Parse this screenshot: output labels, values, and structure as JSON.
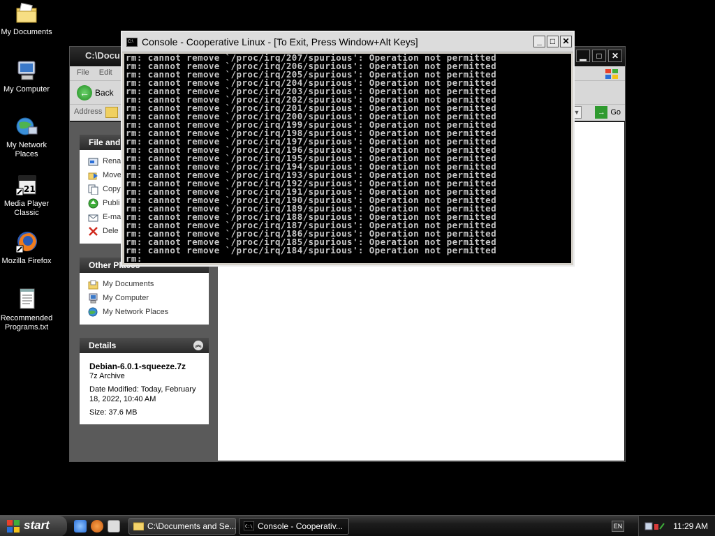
{
  "desktop": {
    "icons": [
      {
        "label": "My Documents"
      },
      {
        "label": "My Computer"
      },
      {
        "label": "My Network Places"
      },
      {
        "label": "Media Player Classic"
      },
      {
        "label": "Mozilla Firefox"
      },
      {
        "label": "Recommended Programs.txt"
      }
    ]
  },
  "explorer": {
    "title": "C:\\Docu",
    "menu": [
      "File",
      "Edit"
    ],
    "back_label": "Back",
    "address_label": "Address",
    "go_label": "Go",
    "file_tasks": {
      "header": "File and",
      "items": [
        "Rena",
        "Move",
        "Copy",
        "Publi",
        "E-ma",
        "Dele"
      ]
    },
    "other_places": {
      "header": "Other Places",
      "items": [
        "My Documents",
        "My Computer",
        "My Network Places"
      ]
    },
    "details": {
      "header": "Details",
      "file_name": "Debian-6.0.1-squeeze.7z",
      "file_type": "7z Archive",
      "date_modified": "Date Modified: Today, February 18, 2022, 10:40 AM",
      "size": "Size: 37.6 MB"
    }
  },
  "console": {
    "title": "Console - Cooperative Linux - [To Exit, Press Window+Alt Keys]",
    "lines": [
      "rm: cannot remove `/proc/irq/207/spurious': Operation not permitted",
      "rm: cannot remove `/proc/irq/206/spurious': Operation not permitted",
      "rm: cannot remove `/proc/irq/205/spurious': Operation not permitted",
      "rm: cannot remove `/proc/irq/204/spurious': Operation not permitted",
      "rm: cannot remove `/proc/irq/203/spurious': Operation not permitted",
      "rm: cannot remove `/proc/irq/202/spurious': Operation not permitted",
      "rm: cannot remove `/proc/irq/201/spurious': Operation not permitted",
      "rm: cannot remove `/proc/irq/200/spurious': Operation not permitted",
      "rm: cannot remove `/proc/irq/199/spurious': Operation not permitted",
      "rm: cannot remove `/proc/irq/198/spurious': Operation not permitted",
      "rm: cannot remove `/proc/irq/197/spurious': Operation not permitted",
      "rm: cannot remove `/proc/irq/196/spurious': Operation not permitted",
      "rm: cannot remove `/proc/irq/195/spurious': Operation not permitted",
      "rm: cannot remove `/proc/irq/194/spurious': Operation not permitted",
      "rm: cannot remove `/proc/irq/193/spurious': Operation not permitted",
      "rm: cannot remove `/proc/irq/192/spurious': Operation not permitted",
      "rm: cannot remove `/proc/irq/191/spurious': Operation not permitted",
      "rm: cannot remove `/proc/irq/190/spurious': Operation not permitted",
      "rm: cannot remove `/proc/irq/189/spurious': Operation not permitted",
      "rm: cannot remove `/proc/irq/188/spurious': Operation not permitted",
      "rm: cannot remove `/proc/irq/187/spurious': Operation not permitted",
      "rm: cannot remove `/proc/irq/186/spurious': Operation not permitted",
      "rm: cannot remove `/proc/irq/185/spurious': Operation not permitted",
      "rm: cannot remove `/proc/irq/184/spurious': Operation not permitted",
      "rm:"
    ]
  },
  "taskbar": {
    "start_label": "start",
    "tasks": [
      {
        "label": "C:\\Documents and Se..."
      },
      {
        "label": "Console - Cooperativ..."
      }
    ],
    "language": "EN",
    "clock": "11:29 AM"
  },
  "colors": {
    "console_bg": "#000000",
    "console_text": "#c8c8c8",
    "desktop_bg": "#000000"
  }
}
